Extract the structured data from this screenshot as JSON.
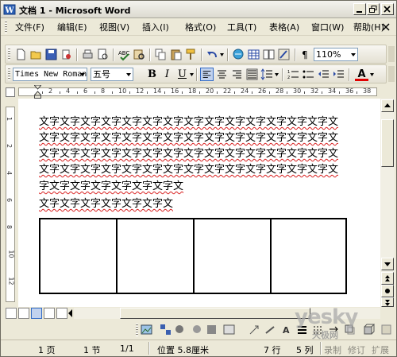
{
  "window": {
    "title": "文档 1 - Microsoft Word"
  },
  "menubar": {
    "items": [
      "文件(F)",
      "编辑(E)",
      "视图(V)",
      "插入(I)",
      "格式(O)",
      "工具(T)",
      "表格(A)",
      "窗口(W)",
      "帮助(H)"
    ]
  },
  "toolbar": {
    "zoom": "110%",
    "font": "Times New Roman",
    "size": "五号",
    "bold": "B",
    "italic": "I",
    "underline": "U",
    "font_color_label": "A"
  },
  "ruler": {
    "numbers": [
      "2",
      "4",
      "6",
      "8",
      "10",
      "12",
      "14",
      "16",
      "18",
      "20",
      "22",
      "24",
      "26",
      "28",
      "30",
      "32",
      "34",
      "36",
      "38"
    ]
  },
  "vruler": {
    "numbers": [
      "1",
      "2",
      "4",
      "6",
      "8",
      "10",
      "12"
    ]
  },
  "document": {
    "lines": [
      "文字文字文字文字文字文字文字文字文字文字文字文字文字文字文",
      "文字文字文字文字文字文字文字文字文字文字文字文字文字文字文",
      "文字文字文字文字文字文字文字文字文字文字文字文字文字文字文",
      "文字文字文字文字文字文字文字文字文字文字文字文字文字文字文",
      "字文字文字文字文字文字文字文",
      "文字文字文字文字文字文字文"
    ],
    "table": {
      "columns": 4,
      "rows": 1
    }
  },
  "statusbar": {
    "page": "1 页",
    "section": "1 节",
    "page_of": "1/1",
    "position": "位置 5.8厘米",
    "line": "7 行",
    "column": "5 列",
    "rec": "录制",
    "trk": "修订",
    "ext": "扩展"
  },
  "watermark": {
    "main": "yesky",
    "sub": "天极网"
  },
  "colors": {
    "chrome": "#ece9d8",
    "spell_underline": "#d82020",
    "ruler_white": "#ffffff"
  }
}
